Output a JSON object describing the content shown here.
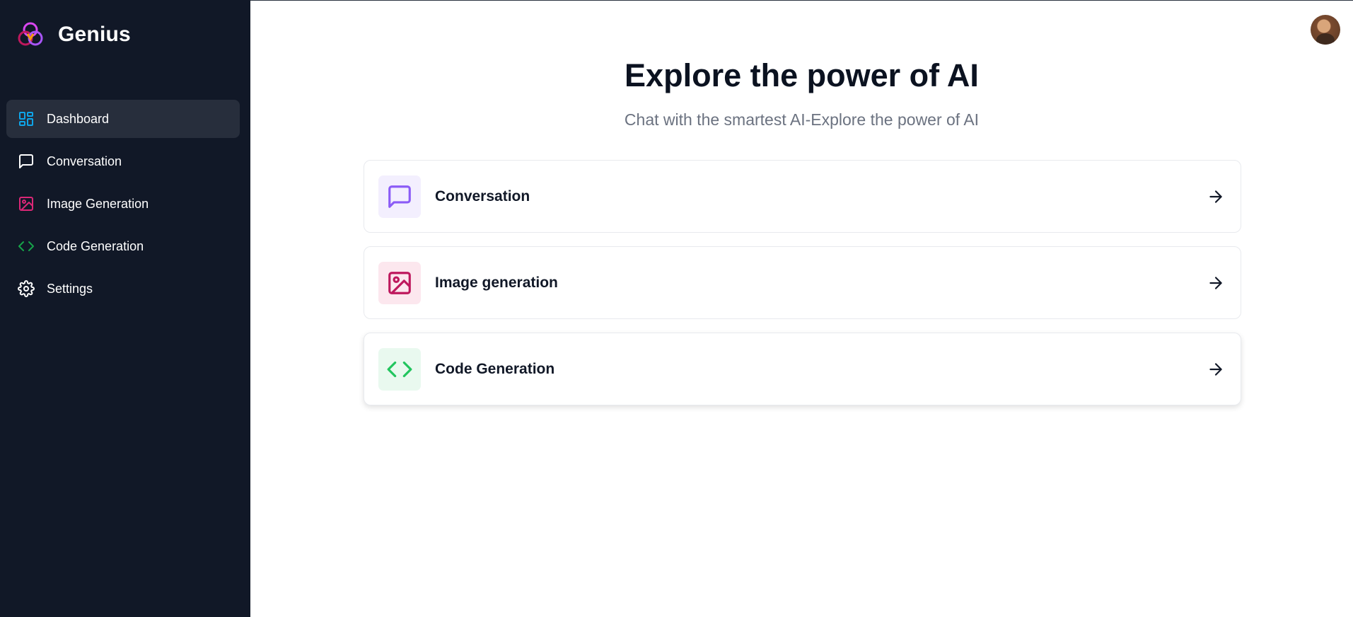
{
  "app": {
    "name": "Genius"
  },
  "sidebar": {
    "items": [
      {
        "label": "Dashboard",
        "icon": "layout-dashboard-icon",
        "color": "#0ea5e9",
        "active": true
      },
      {
        "label": "Conversation",
        "icon": "message-square-icon",
        "color": "#ffffff",
        "active": false
      },
      {
        "label": "Image Generation",
        "icon": "image-icon",
        "color": "#db2777",
        "active": false
      },
      {
        "label": "Code Generation",
        "icon": "code-icon",
        "color": "#16a34a",
        "active": false
      },
      {
        "label": "Settings",
        "icon": "settings-gear-icon",
        "color": "#ffffff",
        "active": false
      }
    ]
  },
  "main": {
    "title": "Explore the power of AI",
    "subtitle": "Chat with the smartest AI-Explore the power of AI",
    "tools": [
      {
        "label": "Conversation",
        "icon": "message-square-icon",
        "color": "#8b5cf6",
        "bg": "#f3effe"
      },
      {
        "label": "Image generation",
        "icon": "image-icon",
        "color": "#be185d",
        "bg": "#fce7ee"
      },
      {
        "label": "Code Generation",
        "icon": "code-icon",
        "color": "#22c55e",
        "bg": "#e9f9ef"
      }
    ]
  },
  "colors": {
    "sidebar_bg": "#111827",
    "active_item_bg": "#272e3c"
  }
}
